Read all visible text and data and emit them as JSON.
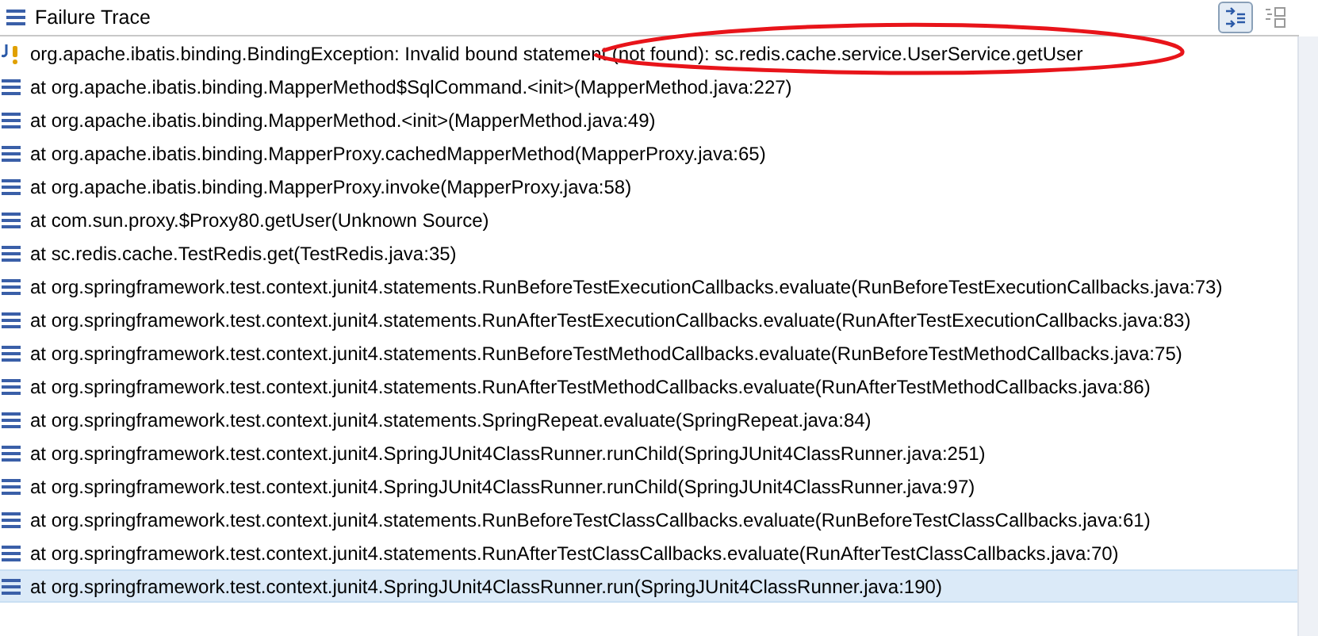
{
  "panel": {
    "title": "Failure Trace",
    "toolbar": [
      {
        "kind": "filter",
        "selected": true
      },
      {
        "kind": "compare",
        "selected": false
      }
    ]
  },
  "trace": [
    {
      "kind": "exception",
      "text": "org.apache.ibatis.binding.BindingException: Invalid bound statement (not found): sc.redis.cache.service.UserService.getUser",
      "selected": false
    },
    {
      "kind": "frame",
      "text": "at org.apache.ibatis.binding.MapperMethod$SqlCommand.<init>(MapperMethod.java:227)",
      "selected": false
    },
    {
      "kind": "frame",
      "text": "at org.apache.ibatis.binding.MapperMethod.<init>(MapperMethod.java:49)",
      "selected": false
    },
    {
      "kind": "frame",
      "text": "at org.apache.ibatis.binding.MapperProxy.cachedMapperMethod(MapperProxy.java:65)",
      "selected": false
    },
    {
      "kind": "frame",
      "text": "at org.apache.ibatis.binding.MapperProxy.invoke(MapperProxy.java:58)",
      "selected": false
    },
    {
      "kind": "frame",
      "text": "at com.sun.proxy.$Proxy80.getUser(Unknown Source)",
      "selected": false
    },
    {
      "kind": "frame",
      "text": "at sc.redis.cache.TestRedis.get(TestRedis.java:35)",
      "selected": false
    },
    {
      "kind": "frame",
      "text": "at org.springframework.test.context.junit4.statements.RunBeforeTestExecutionCallbacks.evaluate(RunBeforeTestExecutionCallbacks.java:73)",
      "selected": false
    },
    {
      "kind": "frame",
      "text": "at org.springframework.test.context.junit4.statements.RunAfterTestExecutionCallbacks.evaluate(RunAfterTestExecutionCallbacks.java:83)",
      "selected": false
    },
    {
      "kind": "frame",
      "text": "at org.springframework.test.context.junit4.statements.RunBeforeTestMethodCallbacks.evaluate(RunBeforeTestMethodCallbacks.java:75)",
      "selected": false
    },
    {
      "kind": "frame",
      "text": "at org.springframework.test.context.junit4.statements.RunAfterTestMethodCallbacks.evaluate(RunAfterTestMethodCallbacks.java:86)",
      "selected": false
    },
    {
      "kind": "frame",
      "text": "at org.springframework.test.context.junit4.statements.SpringRepeat.evaluate(SpringRepeat.java:84)",
      "selected": false
    },
    {
      "kind": "frame",
      "text": "at org.springframework.test.context.junit4.SpringJUnit4ClassRunner.runChild(SpringJUnit4ClassRunner.java:251)",
      "selected": false
    },
    {
      "kind": "frame",
      "text": "at org.springframework.test.context.junit4.SpringJUnit4ClassRunner.runChild(SpringJUnit4ClassRunner.java:97)",
      "selected": false
    },
    {
      "kind": "frame",
      "text": "at org.springframework.test.context.junit4.statements.RunBeforeTestClassCallbacks.evaluate(RunBeforeTestClassCallbacks.java:61)",
      "selected": false
    },
    {
      "kind": "frame",
      "text": "at org.springframework.test.context.junit4.statements.RunAfterTestClassCallbacks.evaluate(RunAfterTestClassCallbacks.java:70)",
      "selected": false
    },
    {
      "kind": "frame",
      "text": "at org.springframework.test.context.junit4.SpringJUnit4ClassRunner.run(SpringJUnit4ClassRunner.java:190)",
      "selected": true
    }
  ]
}
